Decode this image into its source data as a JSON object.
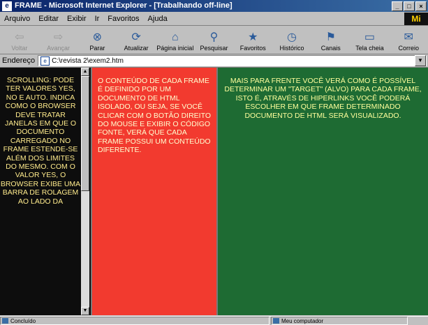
{
  "window": {
    "title": "FRAME - Microsoft Internet Explorer - [Trabalhando off-line]",
    "controls": [
      "_",
      "□",
      "×"
    ]
  },
  "menu": {
    "items": [
      "Arquivo",
      "Editar",
      "Exibir",
      "Ir",
      "Favoritos",
      "Ajuda"
    ],
    "logo": "Mi"
  },
  "toolbar": {
    "buttons": [
      {
        "label": "Voltar",
        "icon": "back-arrow-icon",
        "glyph": "⇦",
        "enabled": false
      },
      {
        "label": "Avançar",
        "icon": "forward-arrow-icon",
        "glyph": "⇨",
        "enabled": false
      },
      {
        "label": "Parar",
        "icon": "stop-icon",
        "glyph": "⊗",
        "enabled": true
      },
      {
        "label": "Atualizar",
        "icon": "refresh-icon",
        "glyph": "⟳",
        "enabled": true
      },
      {
        "label": "Página inicial",
        "icon": "home-icon",
        "glyph": "⌂",
        "enabled": true
      },
      {
        "label": "Pesquisar",
        "icon": "search-icon",
        "glyph": "⚲",
        "enabled": true
      },
      {
        "label": "Favoritos",
        "icon": "favorites-icon",
        "glyph": "★",
        "enabled": true
      },
      {
        "label": "Histórico",
        "icon": "history-icon",
        "glyph": "◷",
        "enabled": true
      },
      {
        "label": "Canais",
        "icon": "channels-icon",
        "glyph": "⚑",
        "enabled": true
      },
      {
        "label": "Tela cheia",
        "icon": "fullscreen-icon",
        "glyph": "▭",
        "enabled": true
      },
      {
        "label": "Correio",
        "icon": "mail-icon",
        "glyph": "✉",
        "enabled": true
      }
    ]
  },
  "address": {
    "label": "Endereço",
    "value": "C:\\revista 2\\exem2.htm"
  },
  "frames": {
    "left_text": "SCROLLING: PODE TER VALORES YES, NO E AUTO. INDICA COMO O BROWSER DEVE TRATAR JANELAS EM QUE O DOCUMENTO CARREGADO NO FRAME ESTENDE-SE ALÉM DOS LIMITES DO MESMO. COM O VALOR YES, O BROWSER EXIBE UMA BARRA DE ROLAGEM AO LADO DA",
    "middle_text": "O CONTEÚDO DE CADA FRAME É DEFINIDO POR UM DOCUMENTO DE HTML ISOLADO, OU SEJA, SE VOCÊ CLICAR COM O BOTÃO DIREITO DO MOUSE E EXIBIR O CÓDIGO FONTE, VERÁ QUE CADA FRAME POSSUI UM CONTEÚDO DIFERENTE.",
    "right_text": "MAIS PARA FRENTE VOCÊ VERÁ COMO É POSSÍVEL DETERMINAR UM \"TARGET\" (ALVO) PARA CADA FRAME, ISTO É, ATRAVÉS DE HIPERLINKS VOCÊ PODERÁ ESCOLHER EM QUE FRAME DETERMINADO DOCUMENTO DE HTML SERÁ VISUALIZADO.",
    "colors": {
      "left_bg": "#0d0d0d",
      "middle_bg": "#f23a2f",
      "right_bg": "#1e6b33"
    }
  },
  "status": {
    "left": "Concluído",
    "right": "Meu computador"
  }
}
